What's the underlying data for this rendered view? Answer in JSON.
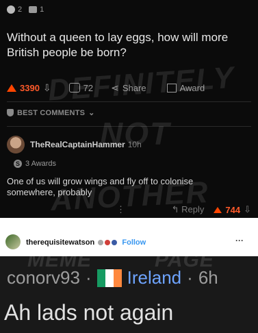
{
  "post": {
    "award_count_1": "2",
    "award_count_2": "1",
    "title": "Without a queen to lay eggs, how will more British people be born?",
    "score": "3390",
    "comments": "72",
    "share_label": "Share",
    "award_label": "Award"
  },
  "sort": {
    "label": "BEST COMMENTS"
  },
  "comment": {
    "username": "TheRealCaptainHammer",
    "time": "10h",
    "awards": "3 Awards",
    "text": "One of us will grow wings and fly off to colonise somewhere, probably",
    "reply_label": "Reply",
    "score": "744"
  },
  "watermark": {
    "line1": "DEFINITELY",
    "line2": "NOT",
    "line3": "ANOTHER",
    "meme": "MEME",
    "page": "PAGE"
  },
  "instagram": {
    "username": "therequisitewatson",
    "follow_label": "Follow",
    "more": "···"
  },
  "reply": {
    "user": "conorv93",
    "sep1": "·",
    "country": "Ireland",
    "sep2": "·",
    "time": "6h",
    "text": "Ah lads not again"
  },
  "colors": {
    "accent": "#ff4500",
    "link": "#3897f0",
    "ireland_green": "#169b62",
    "ireland_orange": "#ff883e"
  }
}
